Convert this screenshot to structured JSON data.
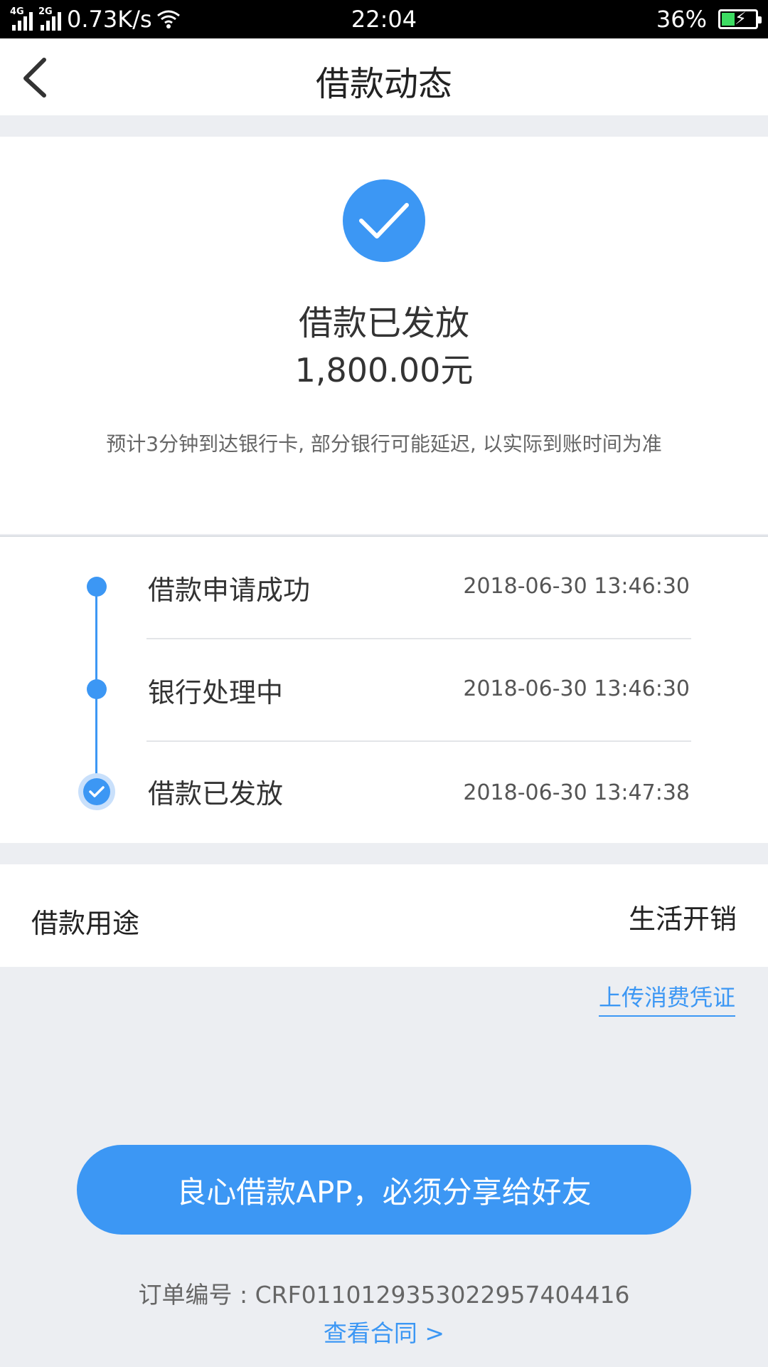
{
  "status_bar": {
    "network_1": "4G",
    "network_2": "2G",
    "speed": "0.73K/s",
    "time": "22:04",
    "battery": "36%"
  },
  "nav": {
    "title": "借款动态",
    "back_icon": "chevron-left-icon"
  },
  "result": {
    "icon": "check-circle-icon",
    "title": "借款已发放",
    "amount": "1,800.00元",
    "notice": "预计3分钟到达银行卡, 部分银行可能延迟, 以实际到账时间为准"
  },
  "timeline": [
    {
      "label": "借款申请成功",
      "time": "2018-06-30 13:46:30"
    },
    {
      "label": "银行处理中",
      "time": "2018-06-30 13:46:30"
    },
    {
      "label": "借款已发放",
      "time": "2018-06-30 13:47:38"
    }
  ],
  "purpose": {
    "label": "借款用途",
    "value": "生活开销"
  },
  "upload_link": "上传消费凭证",
  "share_button": "良心借款APP，必须分享给好友",
  "order": {
    "text": "订单编号 : CRF0110129353022957404416"
  },
  "contract_link": "查看合同 >",
  "colors": {
    "accent": "#3c97f4",
    "background": "#eceef2"
  }
}
